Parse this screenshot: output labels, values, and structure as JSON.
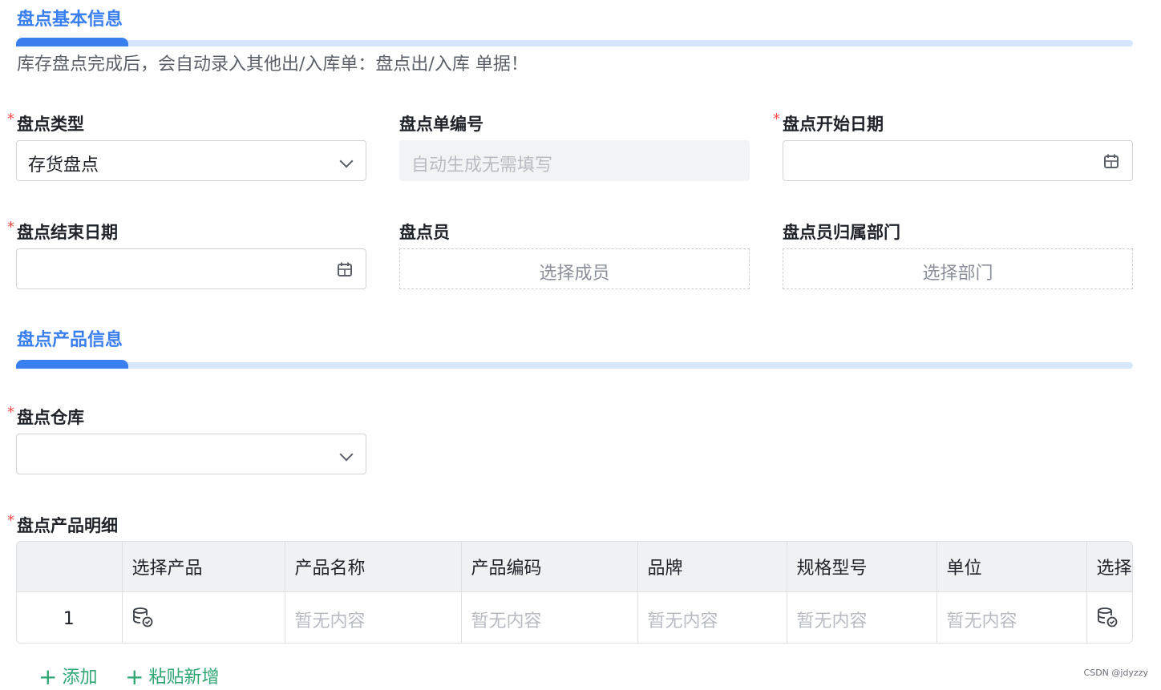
{
  "section1": {
    "title": "盘点基本信息",
    "notice": "库存盘点完成后，会自动录入其他出/入库单：盘点出/入库 单据！"
  },
  "fields": {
    "type": {
      "label": "盘点类型",
      "required": "*",
      "value": "存货盘点"
    },
    "number": {
      "label": "盘点单编号",
      "placeholder": "自动生成无需填写"
    },
    "start": {
      "label": "盘点开始日期",
      "required": "*"
    },
    "end": {
      "label": "盘点结束日期",
      "required": "*"
    },
    "staff": {
      "label": "盘点员",
      "button": "选择成员"
    },
    "dept": {
      "label": "盘点员归属部门",
      "button": "选择部门"
    },
    "warehouse": {
      "label": "盘点仓库",
      "required": "*"
    },
    "detail": {
      "label": "盘点产品明细",
      "required": "*"
    }
  },
  "section2": {
    "title": "盘点产品信息"
  },
  "table": {
    "headers": [
      "",
      "选择产品",
      "产品名称",
      "产品编码",
      "品牌",
      "规格型号",
      "单位",
      "选择"
    ],
    "row": {
      "index": "1",
      "empty": "暂无内容"
    }
  },
  "actions": {
    "add": "添加",
    "paste_add": "粘贴新增",
    "plus": "+"
  },
  "watermark": "CSDN @jdyzzy",
  "colors": {
    "accent": "#3a7ff0",
    "required": "#f54a45",
    "action": "#2ea672"
  }
}
